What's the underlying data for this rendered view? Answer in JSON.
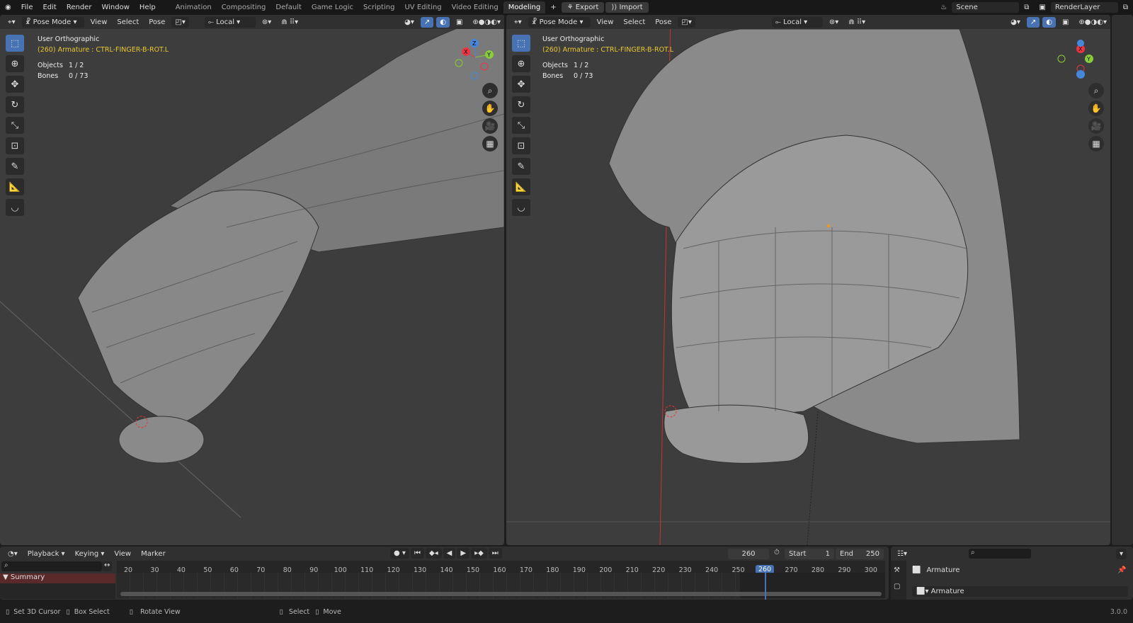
{
  "topbar": {
    "menus": [
      "File",
      "Edit",
      "Render",
      "Window",
      "Help"
    ],
    "workspaces": [
      "Animation",
      "Compositing",
      "Default",
      "Game Logic",
      "Scripting",
      "UV Editing",
      "Video Editing",
      "Modeling"
    ],
    "active_workspace": "Modeling",
    "add_tab": "+",
    "export": "Export",
    "import": "Import",
    "scene": "Scene",
    "render_layer": "RenderLayer"
  },
  "viewport_header": {
    "mode": "Pose Mode",
    "view": "View",
    "select": "Select",
    "pose": "Pose",
    "orientation": "Local"
  },
  "left_view": {
    "title": "User Orthographic",
    "selection": "(260) Armature : CTRL-FINGER-B-ROT.L",
    "objects_label": "Objects",
    "objects_value": "1 / 2",
    "bones_label": "Bones",
    "bones_value": "0 / 73"
  },
  "right_view": {
    "title": "User Orthographic",
    "selection": "(260) Armature : CTRL-FINGER-B-ROT.L",
    "objects_label": "Objects",
    "objects_value": "1 / 2",
    "bones_label": "Bones",
    "bones_value": "0 / 73"
  },
  "gizmo": {
    "x": "X",
    "y": "Y",
    "z": "Z"
  },
  "timeline": {
    "playback": "Playback",
    "keying": "Keying",
    "view": "View",
    "marker": "Marker",
    "current_frame": "260",
    "start_label": "Start",
    "start": "1",
    "end_label": "End",
    "end": "250",
    "summary": "Summary",
    "ticks": [
      "20",
      "30",
      "40",
      "50",
      "60",
      "70",
      "80",
      "90",
      "100",
      "110",
      "120",
      "130",
      "140",
      "150",
      "160",
      "170",
      "180",
      "190",
      "200",
      "210",
      "220",
      "230",
      "240",
      "250",
      "260",
      "270",
      "280",
      "290",
      "300"
    ]
  },
  "properties": {
    "object_name": "Armature",
    "data_name": "Armature"
  },
  "status": {
    "set_cursor": "Set 3D Cursor",
    "box_select": "Box Select",
    "rotate_view": "Rotate View",
    "select": "Select",
    "move": "Move",
    "version": "3.0.0"
  },
  "colors": {
    "accent": "#4772b3",
    "selection_text": "#e8c830",
    "summary": "#5a2a2a"
  }
}
